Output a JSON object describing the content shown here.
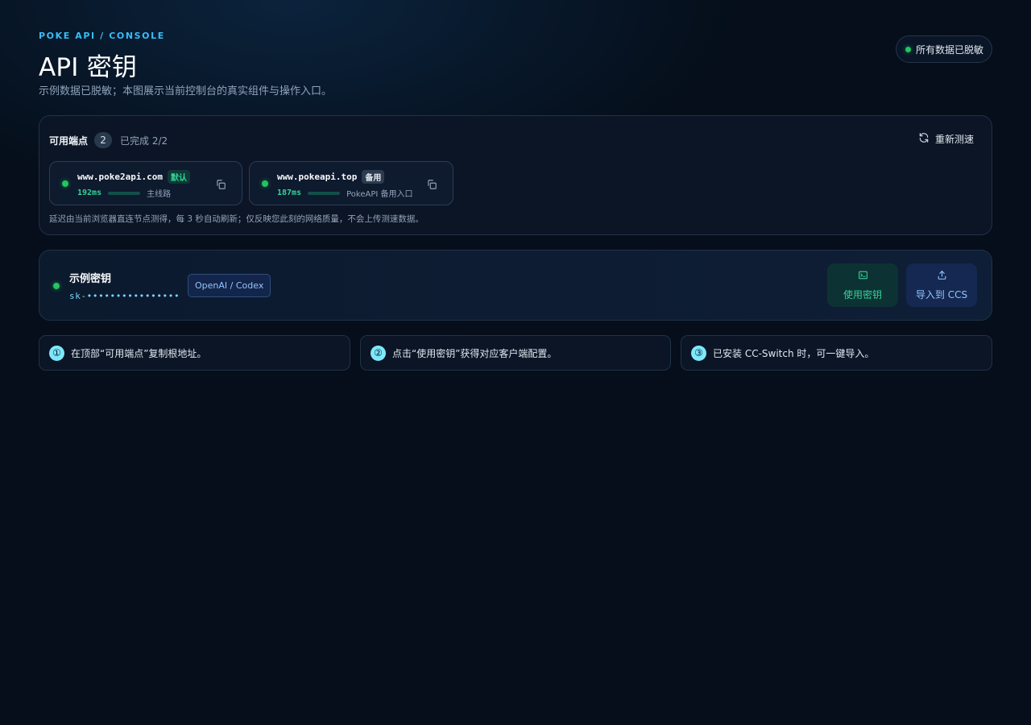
{
  "header": {
    "eyebrow": "POKE API / CONSOLE",
    "title": "API 密钥",
    "subtitle": "示例数据已脱敏；本图展示当前控制台的真实组件与操作入口。",
    "privacy_badge": "所有数据已脱敏"
  },
  "endpoints": {
    "title": "可用端点",
    "count": "2",
    "progress": "已完成 2/2",
    "retest_label": "重新测速",
    "items": [
      {
        "host": "www.poke2api.com",
        "tag": "默认",
        "latency": "192ms",
        "latency_level": 0.92,
        "note": "主线路"
      },
      {
        "host": "www.pokeapi.top",
        "tag": "备用",
        "latency": "187ms",
        "latency_level": 0.95,
        "note": "PokeAPI 备用入口"
      }
    ],
    "footnote": "延迟由当前浏览器直连节点测得，每 3 秒自动刷新；仅反映您此刻的网络质量，不会上传测速数据。"
  },
  "key": {
    "name": "示例密钥",
    "value": "sk-••••••••••••••••",
    "badge": "OpenAI / Codex",
    "use_label": "使用密钥",
    "import_label": "导入到 CCS"
  },
  "steps": [
    {
      "num": "①",
      "text": "在顶部“可用端点”复制根地址。"
    },
    {
      "num": "②",
      "text": "点击“使用密钥”获得对应客户端配置。"
    },
    {
      "num": "③",
      "text": "已安装 CC-Switch 时，可一键导入。"
    }
  ],
  "colors": {
    "background": "#050e1a",
    "accent": "#38bdf8",
    "status_ok": "#22c55e",
    "latency": "#34d399"
  },
  "icons": {
    "retest": "refresh-icon",
    "copy": "copy-icon",
    "use": "terminal-icon",
    "import": "upload-icon"
  }
}
